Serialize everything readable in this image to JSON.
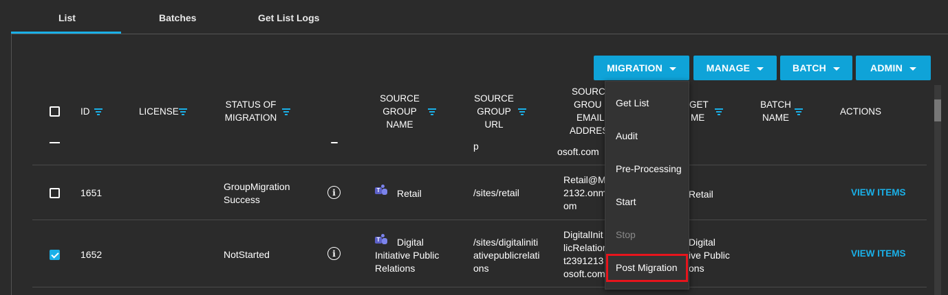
{
  "tabs": [
    {
      "label": "List",
      "active": true
    },
    {
      "label": "Batches",
      "active": false
    },
    {
      "label": "Get List Logs",
      "active": false
    }
  ],
  "toolbar": {
    "migration": "MIGRATION",
    "manage": "MANAGE",
    "batch": "BATCH",
    "admin": "ADMIN"
  },
  "columns": {
    "id": "ID",
    "license": "LICENSE",
    "status_l1": "STATUS OF",
    "status_l2": "MIGRATION",
    "sgn_l1": "SOURCE",
    "sgn_l2": "GROUP",
    "sgn_l3": "NAME",
    "sgu_l1": "SOURCE",
    "sgu_l2": "GROUP",
    "sgu_l3": "URL",
    "sge_l1": "SOURC",
    "sge_l2": "GROU",
    "sge_l3": "EMAIL",
    "sge_l4": "ADDRES",
    "tgt_l1": "GET",
    "tgt_l2": "ME",
    "batch_l1": "BATCH",
    "batch_l2": "NAME",
    "actions": "ACTIONS"
  },
  "partial_row": {
    "url_tail": "p",
    "email_tail": "osoft.com"
  },
  "rows": [
    {
      "id": "1651",
      "status_l1": "GroupMigration",
      "status_l2": "Success",
      "name_l1": "Retail",
      "url_l1": "/sites/retail",
      "email_l1": "Retail@M",
      "email_l2": "2132.onm",
      "email_l3": "om",
      "target_l1": "Retail",
      "action": "VIEW ITEMS",
      "checked": false
    },
    {
      "id": "1652",
      "status_l1": "NotStarted",
      "name_l1": "Digital",
      "name_l2": "Initiative Public",
      "name_l3": "Relations",
      "url_l1": "/sites/digitaliniti",
      "url_l2": "ativepublicrelati",
      "url_l3": "ons",
      "email_l1": "DigitalInit",
      "email_l2": "licRelation",
      "email_l3": "t2391213",
      "email_l4": "osoft.com",
      "target_l1": "Digital",
      "target_l2": "ive Public",
      "target_l3": "ons",
      "action": "VIEW ITEMS",
      "checked": true
    }
  ],
  "migration_menu": [
    {
      "label": "Get List",
      "enabled": true
    },
    {
      "label": "Audit",
      "enabled": true
    },
    {
      "label": "Pre-Processing",
      "enabled": true
    },
    {
      "label": "Start",
      "enabled": true
    },
    {
      "label": "Stop",
      "enabled": false
    },
    {
      "label": "Post Migration",
      "enabled": true,
      "highlighted": true
    }
  ],
  "colors": {
    "accent": "#0fa3d8",
    "link": "#1ab0e8",
    "highlight": "#e8141c",
    "background": "#2b2b2b"
  }
}
